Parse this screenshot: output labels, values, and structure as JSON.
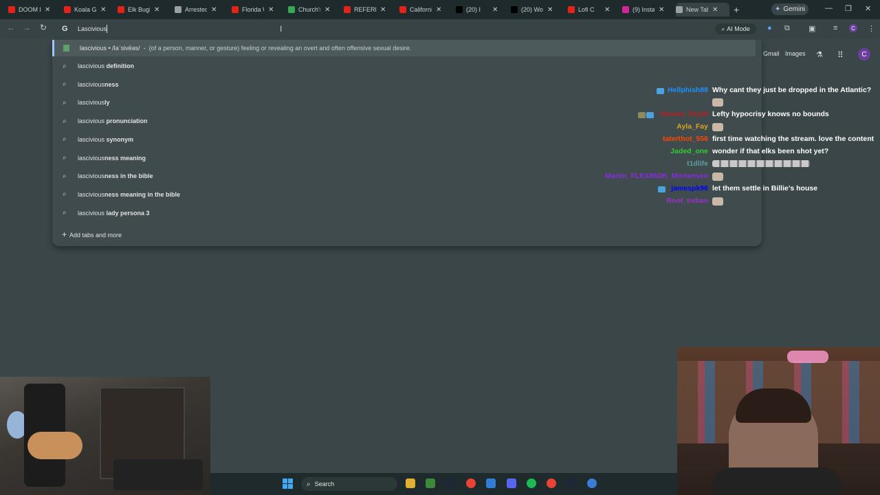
{
  "tabs": [
    {
      "title": "DOOM F",
      "icon": "youtube-icon",
      "color": "#e62117"
    },
    {
      "title": "Koala Ge",
      "icon": "youtube-icon",
      "color": "#e62117"
    },
    {
      "title": "Elk Bugle",
      "icon": "youtube-icon",
      "color": "#e62117"
    },
    {
      "title": "Arrested",
      "icon": "globe-icon",
      "color": "#9aa0a6"
    },
    {
      "title": "Florida W",
      "icon": "youtube-icon",
      "color": "#e62117"
    },
    {
      "title": "Church's",
      "icon": "maps-icon",
      "color": "#34a853"
    },
    {
      "title": "REFEREE",
      "icon": "youtube-icon",
      "color": "#e62117"
    },
    {
      "title": "California",
      "icon": "youtube-icon",
      "color": "#e62117"
    },
    {
      "title": "(20) I",
      "icon": "x-icon",
      "color": "#000000"
    },
    {
      "title": "(20) Worl",
      "icon": "x-icon",
      "color": "#000000"
    },
    {
      "title": "Lofi C",
      "icon": "youtube-icon",
      "color": "#e62117"
    },
    {
      "title": "(9) Instag",
      "icon": "instagram-icon",
      "color": "#d6249f"
    },
    {
      "title": "New Tab",
      "icon": "chrome-icon",
      "color": "#9aa0a6",
      "active": true
    }
  ],
  "gemini_label": "Gemini",
  "omnibox": {
    "google_glyph": "G",
    "value": "Lascivious",
    "ai_mode_label": "AI Mode"
  },
  "suggestions": {
    "first": {
      "word": "lascivious",
      "pronunciation": "/ləˈsivēəs/",
      "definition": "(of a person, manner, or gesture) feeling or revealing an overt and often offensive sexual desire."
    },
    "items": [
      {
        "base": "lascivious",
        "bold": " definition"
      },
      {
        "base": "lascivious",
        "bold": "ness"
      },
      {
        "base": "lascivious",
        "bold": "ly"
      },
      {
        "base": "lascivious",
        "bold": " pronunciation"
      },
      {
        "base": "lascivious",
        "bold": " synonym"
      },
      {
        "base": "lascivious",
        "bold": "ness meaning"
      },
      {
        "base": "lascivious",
        "bold": "ness in the bible"
      },
      {
        "base": "lascivious",
        "bold": "ness meaning in the bible"
      },
      {
        "base": "lascivious",
        "bold": " lady persona 3"
      }
    ],
    "add_tabs_label": "Add tabs and more"
  },
  "google_header": {
    "gmail": "Gmail",
    "images": "Images",
    "avatar_letter": "C"
  },
  "chat": [
    {
      "user": "Hellphish88",
      "color": "#1e90ff",
      "message": "Why cant they just be dropped in the Atlantic?"
    },
    {
      "user": "Nomad_Reel8",
      "color": "#b22222",
      "message": "Lefty hypocrisy knows no bounds"
    },
    {
      "user": "Ayla_Fay",
      "color": "#daa520",
      "message": ""
    },
    {
      "user": "taterthot_556",
      "color": "#ff4500",
      "message": "first time watching the stream. love the content"
    },
    {
      "user": "Jaded_one",
      "color": "#32cd32",
      "message": "wonder if that elks been shot yet?"
    },
    {
      "user": "t1dlife",
      "color": "#5f9ea0",
      "message": ""
    },
    {
      "user": "Martin_FLEX86DK_Mortensen",
      "color": "#8a2be2",
      "message": ""
    },
    {
      "user": "jamespk96",
      "color": "#0000ff",
      "message": "let them settle in Billie's house"
    },
    {
      "user": "Roof_Indian",
      "color": "#9932cc",
      "message": ""
    }
  ],
  "taskbar": {
    "search_label": "Search"
  }
}
